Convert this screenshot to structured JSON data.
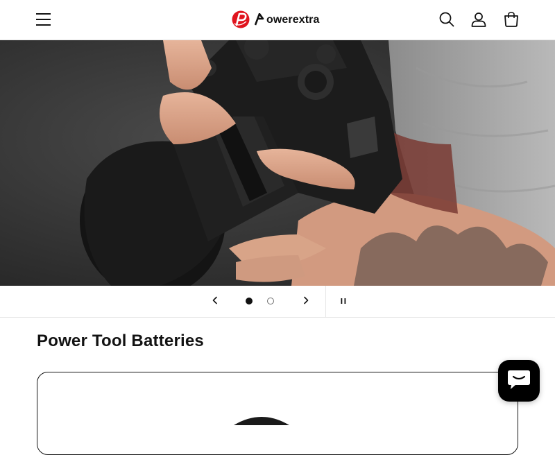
{
  "header": {
    "logo_text": "owerextra",
    "brand_color": "#e0141e",
    "icons": [
      "menu-icon",
      "search-icon",
      "account-icon",
      "cart-icon"
    ]
  },
  "hero": {
    "slide_count": 2,
    "active_slide": 1,
    "icons": [
      "chevron-left-icon",
      "chevron-right-icon",
      "pause-icon"
    ]
  },
  "section": {
    "title": "Power Tool Batteries"
  },
  "chat": {
    "icon": "chat-bubble-icon",
    "color": "#000000"
  }
}
